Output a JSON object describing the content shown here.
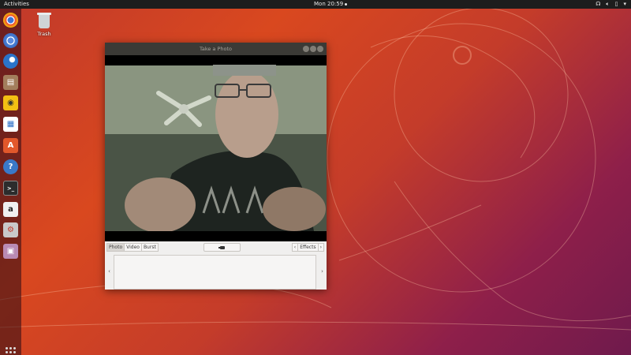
{
  "topbar": {
    "activities": "Activities",
    "clock": "Mon 20:59"
  },
  "tray_icons": [
    "accessibility-icon",
    "volume-icon",
    "battery-icon",
    "power-menu-icon"
  ],
  "dock": {
    "items": [
      {
        "name": "chrome-icon",
        "color": "#e8e8e8"
      },
      {
        "name": "chromium-icon",
        "color": "#3b74d7"
      },
      {
        "name": "thunderbird-icon",
        "color": "#2a74c9"
      },
      {
        "name": "files-icon",
        "color": "#a37e5c"
      },
      {
        "name": "rhythmbox-icon",
        "color": "#f3c013"
      },
      {
        "name": "libreoffice-writer-icon",
        "color": "#2b6fc7"
      },
      {
        "name": "software-center-icon",
        "color": "#e2582b"
      },
      {
        "name": "help-icon",
        "color": "#3a79c8"
      },
      {
        "name": "terminal-icon",
        "color": "#2c2c2c"
      },
      {
        "name": "amazon-icon",
        "color": "#f0f0f0"
      },
      {
        "name": "settings-icon",
        "color": "#c9c9c9"
      },
      {
        "name": "cheese-icon",
        "color": "#b98bb3"
      }
    ]
  },
  "desktop": {
    "trash_label": "Trash"
  },
  "window": {
    "title": "Take a Photo",
    "modes": [
      "Photo",
      "Video",
      "Burst"
    ],
    "active_mode": "Photo",
    "effects_label": "Effects",
    "prev_glyph": "‹",
    "next_glyph": "›"
  }
}
